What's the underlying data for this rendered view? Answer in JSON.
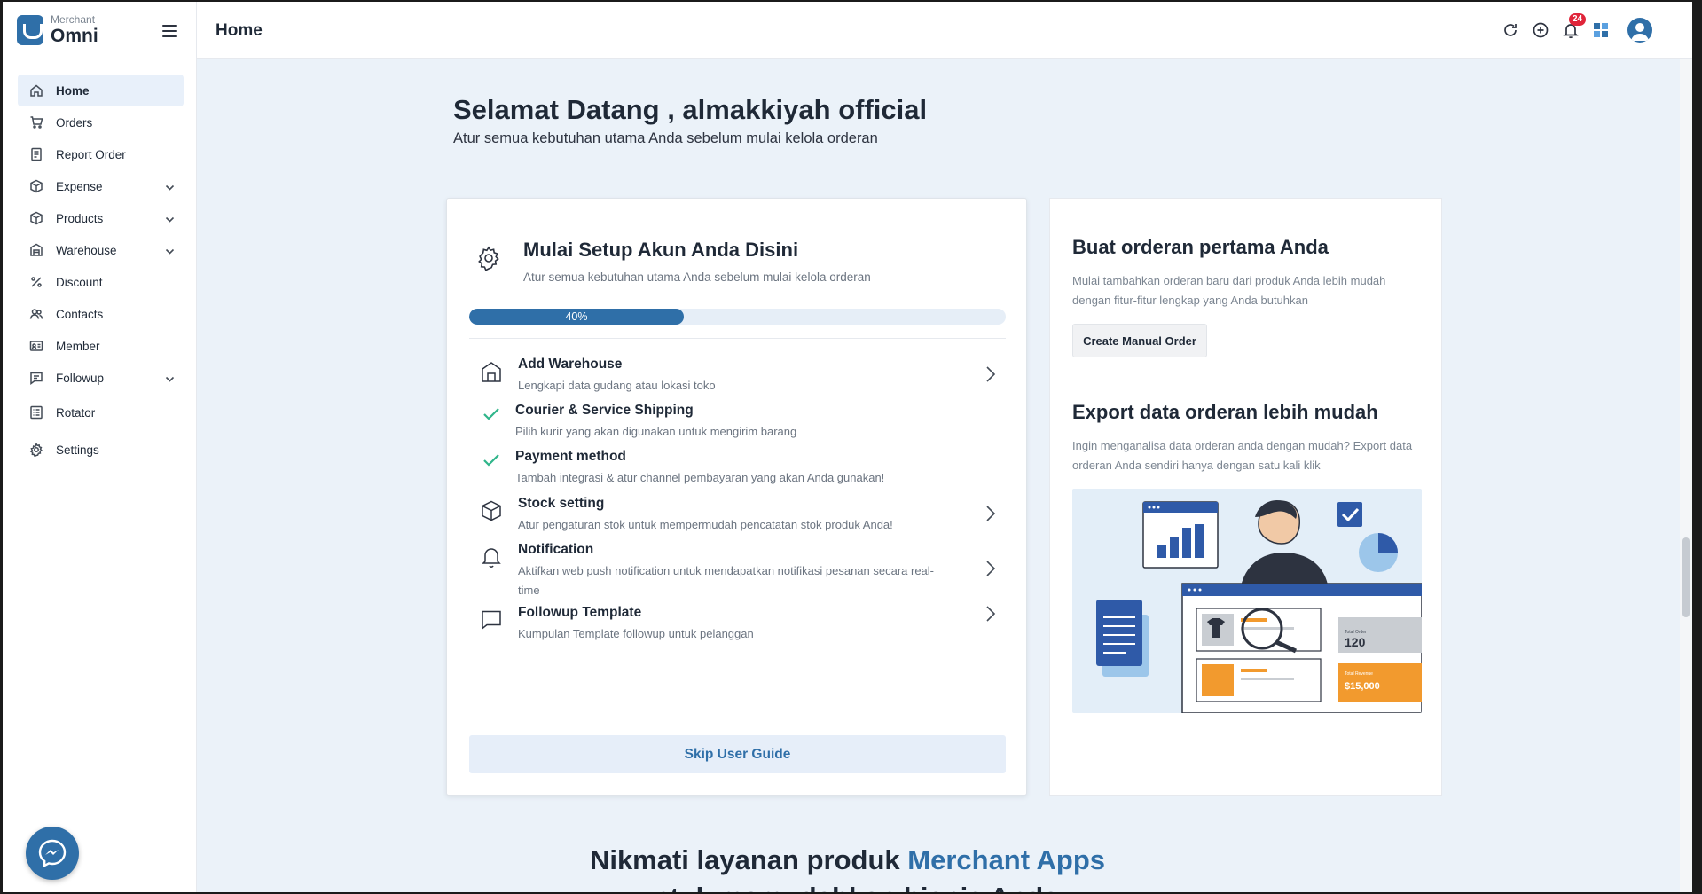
{
  "brand": {
    "small": "Merchant",
    "name": "Omni"
  },
  "header": {
    "title": "Home",
    "notification_count": "24"
  },
  "sidebar": {
    "items": [
      {
        "label": "Home",
        "icon": "home-icon",
        "active": true,
        "expandable": false
      },
      {
        "label": "Orders",
        "icon": "cart-icon",
        "expandable": false
      },
      {
        "label": "Report Order",
        "icon": "report-icon",
        "expandable": false
      },
      {
        "label": "Expense",
        "icon": "box-icon",
        "expandable": true
      },
      {
        "label": "Products",
        "icon": "box-icon",
        "expandable": true
      },
      {
        "label": "Warehouse",
        "icon": "warehouse-icon",
        "expandable": true
      },
      {
        "label": "Discount",
        "icon": "percent-icon",
        "expandable": false
      },
      {
        "label": "Contacts",
        "icon": "contacts-icon",
        "expandable": false
      },
      {
        "label": "Member",
        "icon": "member-card-icon",
        "expandable": false
      },
      {
        "label": "Followup",
        "icon": "chat-icon",
        "expandable": true
      },
      {
        "label": "Rotator",
        "icon": "list-icon",
        "expandable": false
      },
      {
        "label": "Settings",
        "icon": "gear-icon",
        "expandable": false
      }
    ]
  },
  "welcome": {
    "title": "Selamat Datang , almakkiyah official",
    "subtitle": "Atur semua kebutuhan utama Anda sebelum mulai kelola orderan"
  },
  "setup": {
    "title": "Mulai Setup Akun Anda Disini",
    "subtitle": "Atur semua kebutuhan utama Anda sebelum mulai kelola orderan",
    "progress": 40,
    "progress_label": "40%",
    "steps": [
      {
        "title": "Add Warehouse",
        "desc": "Lengkapi data gudang atau lokasi toko",
        "done": false
      },
      {
        "title": "Courier & Service Shipping",
        "desc": "Pilih kurir yang akan digunakan untuk mengirim barang",
        "done": true
      },
      {
        "title": "Payment method",
        "desc": "Tambah integrasi & atur channel pembayaran yang akan Anda gunakan!",
        "done": true
      },
      {
        "title": "Stock setting",
        "desc": "Atur pengaturan stok untuk mempermudah pencatatan stok produk Anda!",
        "done": false
      },
      {
        "title": "Notification",
        "desc": "Aktifkan web push notification untuk mendapatkan notifikasi pesanan secara real-time",
        "done": false
      },
      {
        "title": "Followup Template",
        "desc": "Kumpulan Template followup untuk pelanggan",
        "done": false
      }
    ],
    "skip_label": "Skip User Guide"
  },
  "right_panel": {
    "order_title": "Buat orderan pertama Anda",
    "order_desc": "Mulai tambahkan orderan baru dari produk Anda lebih mudah dengan fitur-fitur lengkap yang Anda butuhkan",
    "order_button": "Create Manual Order",
    "export_title": "Export data orderan lebih mudah",
    "export_desc": "Ingin menganalisa data orderan anda dengan mudah? Export data orderan Anda sendiri hanya dengan satu kali klik",
    "illus_total_label": "Total Order",
    "illus_total_value": "120",
    "illus_amount_label": "Total Revenue",
    "illus_amount_value": "$15,000"
  },
  "bottom": {
    "heading_prefix": "Nikmati layanan produk ",
    "heading_accent": "Merchant Apps",
    "heading_line2": "untuk memudahkan bisnis Anda"
  },
  "colors": {
    "accent": "#2f6fa8",
    "check": "#2fb58a",
    "badge": "#e0253a",
    "background": "#ebf2f9"
  }
}
